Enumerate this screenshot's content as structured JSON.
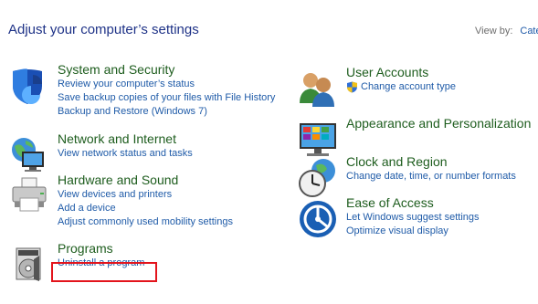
{
  "header": {
    "title": "Adjust your computer’s settings",
    "view_by_label": "View by:",
    "view_by_value": "Cate"
  },
  "categories_left": [
    {
      "title": "System and Security",
      "icon": "shield-icon",
      "links": [
        "Review your computer’s status",
        "Save backup copies of your files with File History",
        "Backup and Restore (Windows 7)"
      ]
    },
    {
      "title": "Network and Internet",
      "icon": "network-globe-icon",
      "links": [
        "View network status and tasks"
      ]
    },
    {
      "title": "Hardware and Sound",
      "icon": "printer-icon",
      "links": [
        "View devices and printers",
        "Add a device",
        "Adjust commonly used mobility settings"
      ]
    },
    {
      "title": "Programs",
      "icon": "programs-disk-icon",
      "links": [
        "Uninstall a program"
      ]
    }
  ],
  "categories_right": [
    {
      "title": "User Accounts",
      "icon": "users-icon",
      "links": [
        "Change account type"
      ]
    },
    {
      "title": "Appearance and Personalization",
      "icon": "monitor-palette-icon",
      "links": []
    },
    {
      "title": "Clock and Region",
      "icon": "clock-globe-icon",
      "links": [
        "Change date, time, or number formats"
      ]
    },
    {
      "title": "Ease of Access",
      "icon": "ease-of-access-icon",
      "links": [
        "Let Windows suggest settings",
        "Optimize visual display"
      ]
    }
  ],
  "colors": {
    "title_green": "#1e5d1e",
    "link_blue": "#1f5ba8",
    "highlight_red": "#e3141c"
  }
}
